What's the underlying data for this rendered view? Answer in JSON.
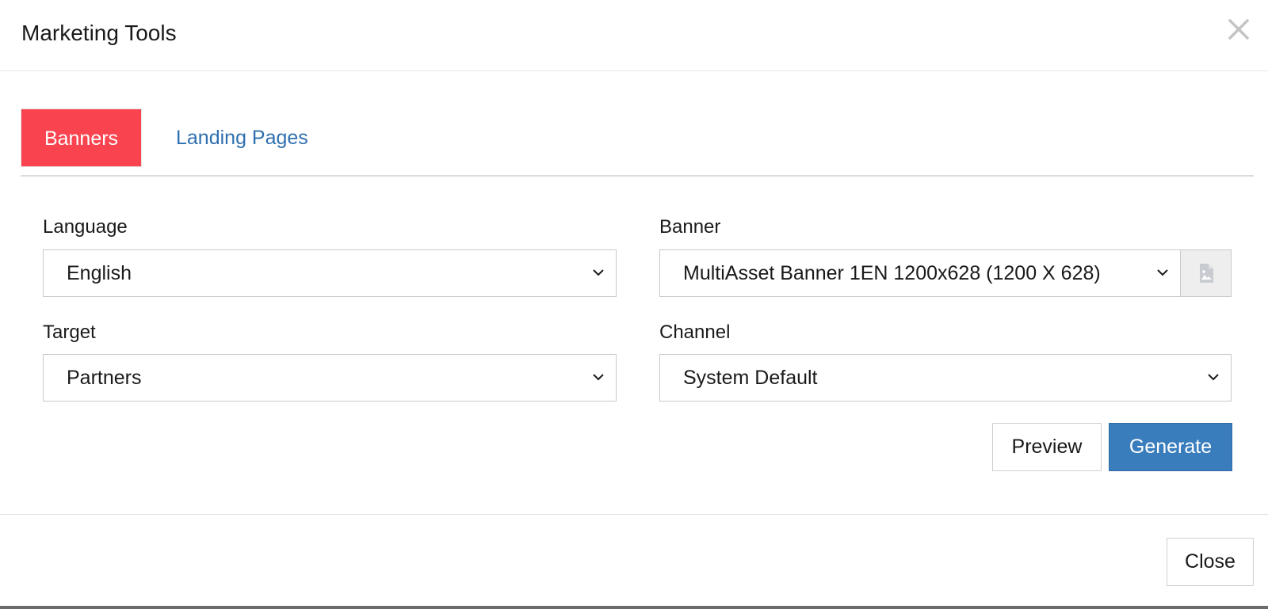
{
  "modal": {
    "title": "Marketing Tools",
    "close_icon": "close-icon"
  },
  "tabs": [
    {
      "label": "Banners",
      "active": true
    },
    {
      "label": "Landing Pages",
      "active": false
    }
  ],
  "form": {
    "language": {
      "label": "Language",
      "value": "English"
    },
    "banner": {
      "label": "Banner",
      "value": "MultiAsset Banner 1EN 1200x628 (1200 X 628)",
      "addon_icon": "image-file-icon"
    },
    "target": {
      "label": "Target",
      "value": "Partners"
    },
    "channel": {
      "label": "Channel",
      "value": "System Default"
    }
  },
  "actions": {
    "preview_label": "Preview",
    "generate_label": "Generate"
  },
  "footer": {
    "close_label": "Close"
  },
  "colors": {
    "active_tab": "#f9434f",
    "link": "#2f6fb0",
    "primary": "#3a7dbd"
  }
}
